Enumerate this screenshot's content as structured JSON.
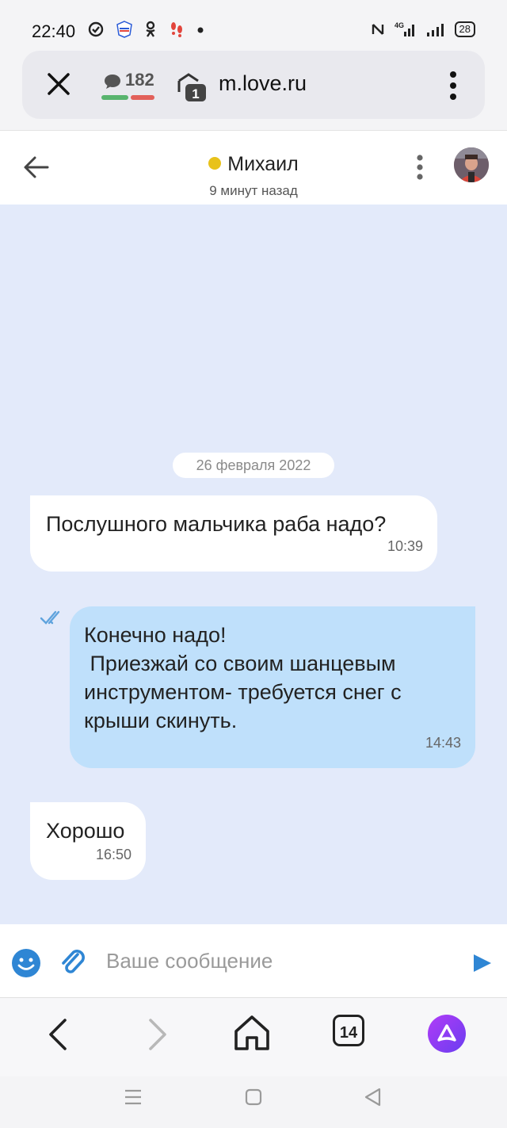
{
  "status_bar": {
    "time": "22:40",
    "battery": "28",
    "network": "4G"
  },
  "browser": {
    "messages_count": "182",
    "tabs_count_small": "1",
    "url": "m.love.ru",
    "tabs_count": "14"
  },
  "chat_header": {
    "contact_name": "Михаил",
    "last_seen": "9 минут назад",
    "online_color": "#e8c21a"
  },
  "chat": {
    "date_separator": "26 февраля 2022",
    "messages": [
      {
        "direction": "incoming",
        "text": "Послушного мальчика раба надо?",
        "time": "10:39"
      },
      {
        "direction": "outgoing",
        "text": "Конечно надо!\n Приезжай со своим шанцевым инструментом- требуется снег с крыши скинуть.",
        "time": "14:43",
        "status": "read"
      },
      {
        "direction": "incoming",
        "text": "Хорошо",
        "time": "16:50"
      }
    ]
  },
  "composer": {
    "placeholder": "Ваше сообщение"
  },
  "colors": {
    "chat_bg": "#e3eafa",
    "outgoing_bubble": "#bfe0fb",
    "incoming_bubble": "#ffffff",
    "accent": "#2f86d4"
  },
  "icons": {
    "close": "close-icon",
    "chat_bubble": "chat-bubble-icon",
    "tabs": "tabs-icon",
    "more": "more-vertical-icon",
    "back": "arrow-left-icon",
    "emoji": "emoji-icon",
    "attach": "paperclip-icon",
    "send": "send-icon",
    "home": "home-icon",
    "alice": "alice-assistant-icon"
  }
}
